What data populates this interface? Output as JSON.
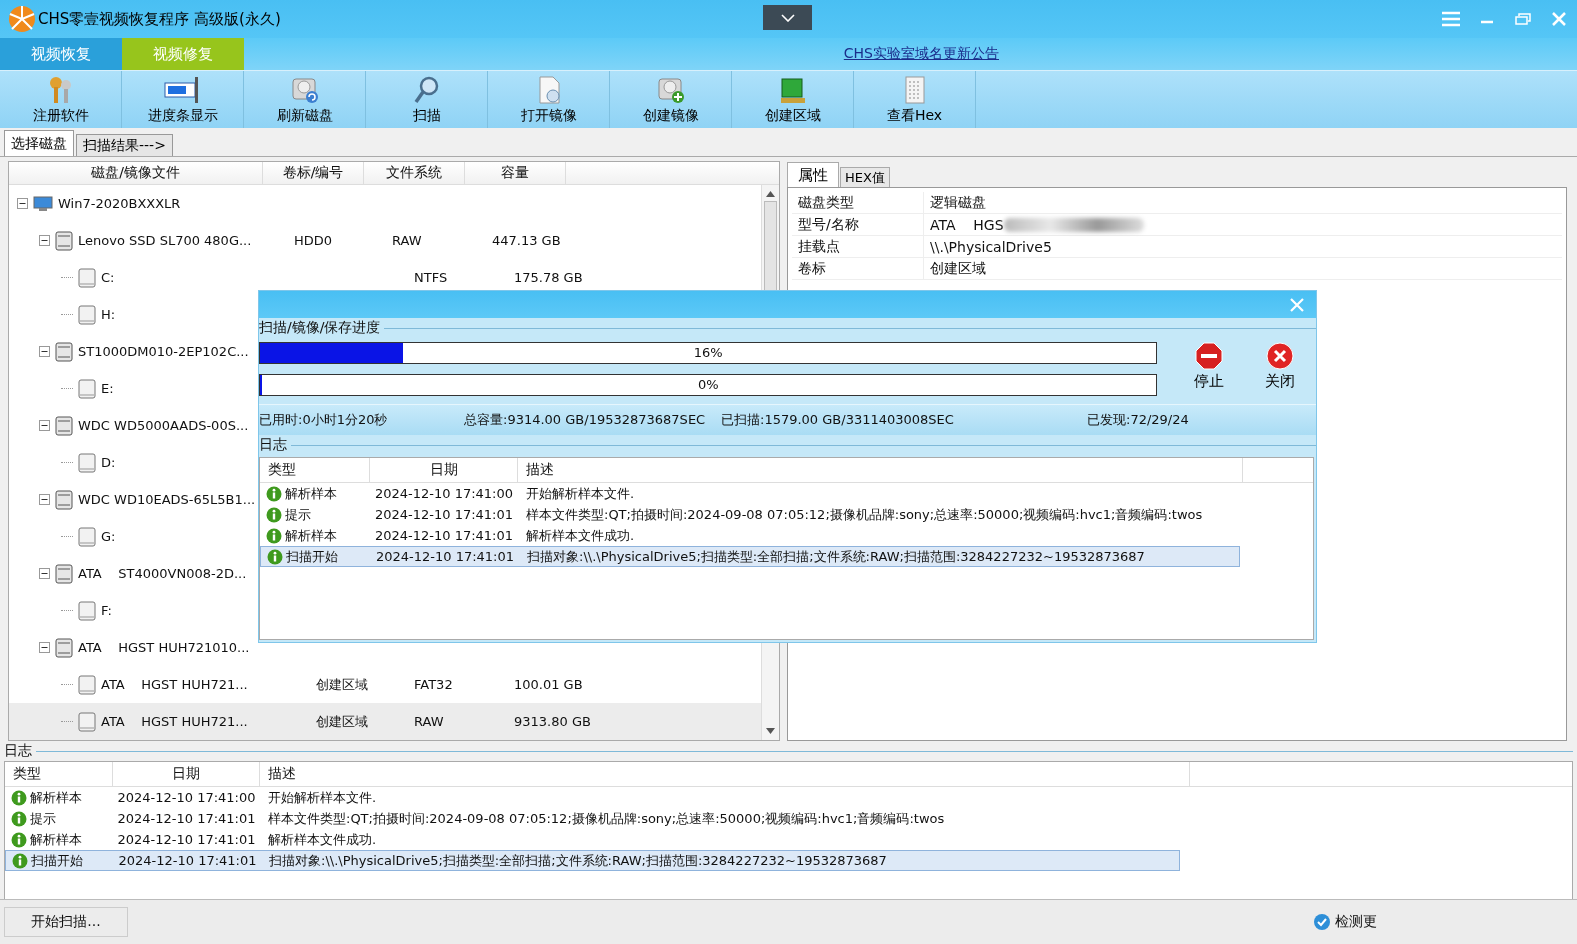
{
  "window": {
    "title": "CHS零壹视频恢复程序 高级版(永久)"
  },
  "mode_tabs": [
    {
      "label": "视频恢复",
      "selected": false
    },
    {
      "label": "视频修复",
      "selected": true
    }
  ],
  "announcement_link": "CHS实验室域名更新公告",
  "toolbar": [
    {
      "label": "注册软件",
      "kind": "keys"
    },
    {
      "label": "进度条显示",
      "kind": "progress"
    },
    {
      "label": "刷新磁盘",
      "kind": "refresh"
    },
    {
      "label": "扫描",
      "kind": "scan"
    },
    {
      "label": "打开镜像",
      "kind": "open-image"
    },
    {
      "label": "创建镜像",
      "kind": "create-image"
    },
    {
      "label": "创建区域",
      "kind": "create-region"
    },
    {
      "label": "查看Hex",
      "kind": "hex"
    }
  ],
  "view_tabs": [
    {
      "label": "选择磁盘",
      "selected": true
    },
    {
      "label": "扫描结果--->",
      "selected": false
    }
  ],
  "disk_tree": {
    "columns": [
      "磁盘/镜像文件",
      "卷标/编号",
      "文件系统",
      "容量"
    ],
    "items": [
      {
        "kind": "computer",
        "name": "Win7-2020BXXXLR",
        "expanded": true,
        "selected": false,
        "children": [
          {
            "kind": "disk",
            "name": "Lenovo SSD SL700 480G...",
            "volume": "HDD0",
            "fs": "RAW",
            "capacity": "447.13 GB",
            "expanded": true,
            "selected": false,
            "children": [
              {
                "kind": "partition",
                "name": "C:",
                "fs": "NTFS",
                "capacity": "175.78 GB",
                "selected": false
              },
              {
                "kind": "partition",
                "name": "H:",
                "selected": false
              }
            ]
          },
          {
            "kind": "disk",
            "name": "ST1000DM010-2EP102C...",
            "expanded": true,
            "selected": false,
            "children": [
              {
                "kind": "partition",
                "name": "E:",
                "selected": false
              }
            ]
          },
          {
            "kind": "disk",
            "name": "WDC WD5000AADS-00S...",
            "expanded": true,
            "selected": false,
            "children": [
              {
                "kind": "partition",
                "name": "D:",
                "selected": false
              }
            ]
          },
          {
            "kind": "disk",
            "name": "WDC WD10EADS-65L5B1...",
            "expanded": true,
            "selected": false,
            "children": [
              {
                "kind": "partition",
                "name": "G:",
                "selected": false
              }
            ]
          },
          {
            "kind": "disk",
            "name": "ATA    ST4000VN008-2D...",
            "expanded": true,
            "selected": false,
            "children": [
              {
                "kind": "partition",
                "name": "F:",
                "selected": false
              }
            ]
          },
          {
            "kind": "disk",
            "name": "ATA    HGST HUH721010...",
            "expanded": true,
            "selected": false,
            "children": [
              {
                "kind": "partition",
                "name": "ATA    HGST HUH721...",
                "volume": "创建区域",
                "fs": "FAT32",
                "capacity": "100.01 GB",
                "selected": false
              },
              {
                "kind": "partition",
                "name": "ATA    HGST HUH721...",
                "volume": "创建区域",
                "fs": "RAW",
                "capacity": "9313.80 GB",
                "selected": true
              }
            ]
          }
        ]
      }
    ]
  },
  "properties": {
    "tabs": [
      {
        "label": "属性",
        "selected": true
      },
      {
        "label": "HEX值",
        "selected": false
      }
    ],
    "rows": [
      {
        "label": "磁盘类型",
        "value": "逻辑磁盘",
        "redacted": false
      },
      {
        "label": "型号/名称",
        "value": "ATA    HGS",
        "redacted": true
      },
      {
        "label": "挂载点",
        "value": "\\\\.\\PhysicalDrive5",
        "redacted": false
      },
      {
        "label": "卷标",
        "value": "创建区域",
        "redacted": false
      }
    ]
  },
  "dialog": {
    "section_title": "扫描/镜像/保存进度",
    "progress": [
      {
        "level": 0.16,
        "reading": "16%"
      },
      {
        "level": 0,
        "reading": "0%"
      }
    ],
    "buttons": [
      {
        "label": "停止",
        "kind": "stop"
      },
      {
        "label": "关闭",
        "kind": "close"
      }
    ],
    "stats": [
      "已用时:0小时1分20秒",
      "总容量:9314.00 GB/19532873687SEC",
      "已扫描:1579.00 GB/3311403008SEC",
      "已发现:72/29/24"
    ],
    "log": {
      "title": "日志",
      "columns": [
        "类型",
        "日期",
        "描述"
      ],
      "rows": [
        {
          "type": "解析样本",
          "date": "2024-12-10 17:41:00",
          "description": "开始解析样本文件.",
          "selected": false
        },
        {
          "type": "提示",
          "date": "2024-12-10 17:41:01",
          "description": "样本文件类型:QT;拍摄时间:2024-09-08 07:05:12;摄像机品牌:sony;总速率:50000;视频编码:hvc1;音频编码:twos",
          "selected": false
        },
        {
          "type": "解析样本",
          "date": "2024-12-10 17:41:01",
          "description": "解析样本文件成功.",
          "selected": false
        },
        {
          "type": "扫描开始",
          "date": "2024-12-10 17:41:01",
          "description": "扫描对象:\\\\.\\PhysicalDrive5;扫描类型:全部扫描;文件系统:RAW;扫描范围:3284227232~19532873687",
          "selected": true
        }
      ]
    }
  },
  "bottom_log": {
    "title": "日志",
    "columns": [
      "类型",
      "日期",
      "描述"
    ],
    "rows": [
      {
        "type": "解析样本",
        "date": "2024-12-10 17:41:00",
        "description": "开始解析样本文件.",
        "selected": false
      },
      {
        "type": "提示",
        "date": "2024-12-10 17:41:01",
        "description": "样本文件类型:QT;拍摄时间:2024-09-08 07:05:12;摄像机品牌:sony;总速率:50000;视频编码:hvc1;音频编码:twos",
        "selected": false
      },
      {
        "type": "解析样本",
        "date": "2024-12-10 17:41:01",
        "description": "解析样本文件成功.",
        "selected": false
      },
      {
        "type": "扫描开始",
        "date": "2024-12-10 17:41:01",
        "description": "扫描对象:\\\\.\\PhysicalDrive5;扫描类型:全部扫描;文件系统:RAW;扫描范围:3284227232~19532873687",
        "selected": true
      }
    ]
  },
  "status_bar": {
    "message": "开始扫描...",
    "update": "检测更"
  }
}
